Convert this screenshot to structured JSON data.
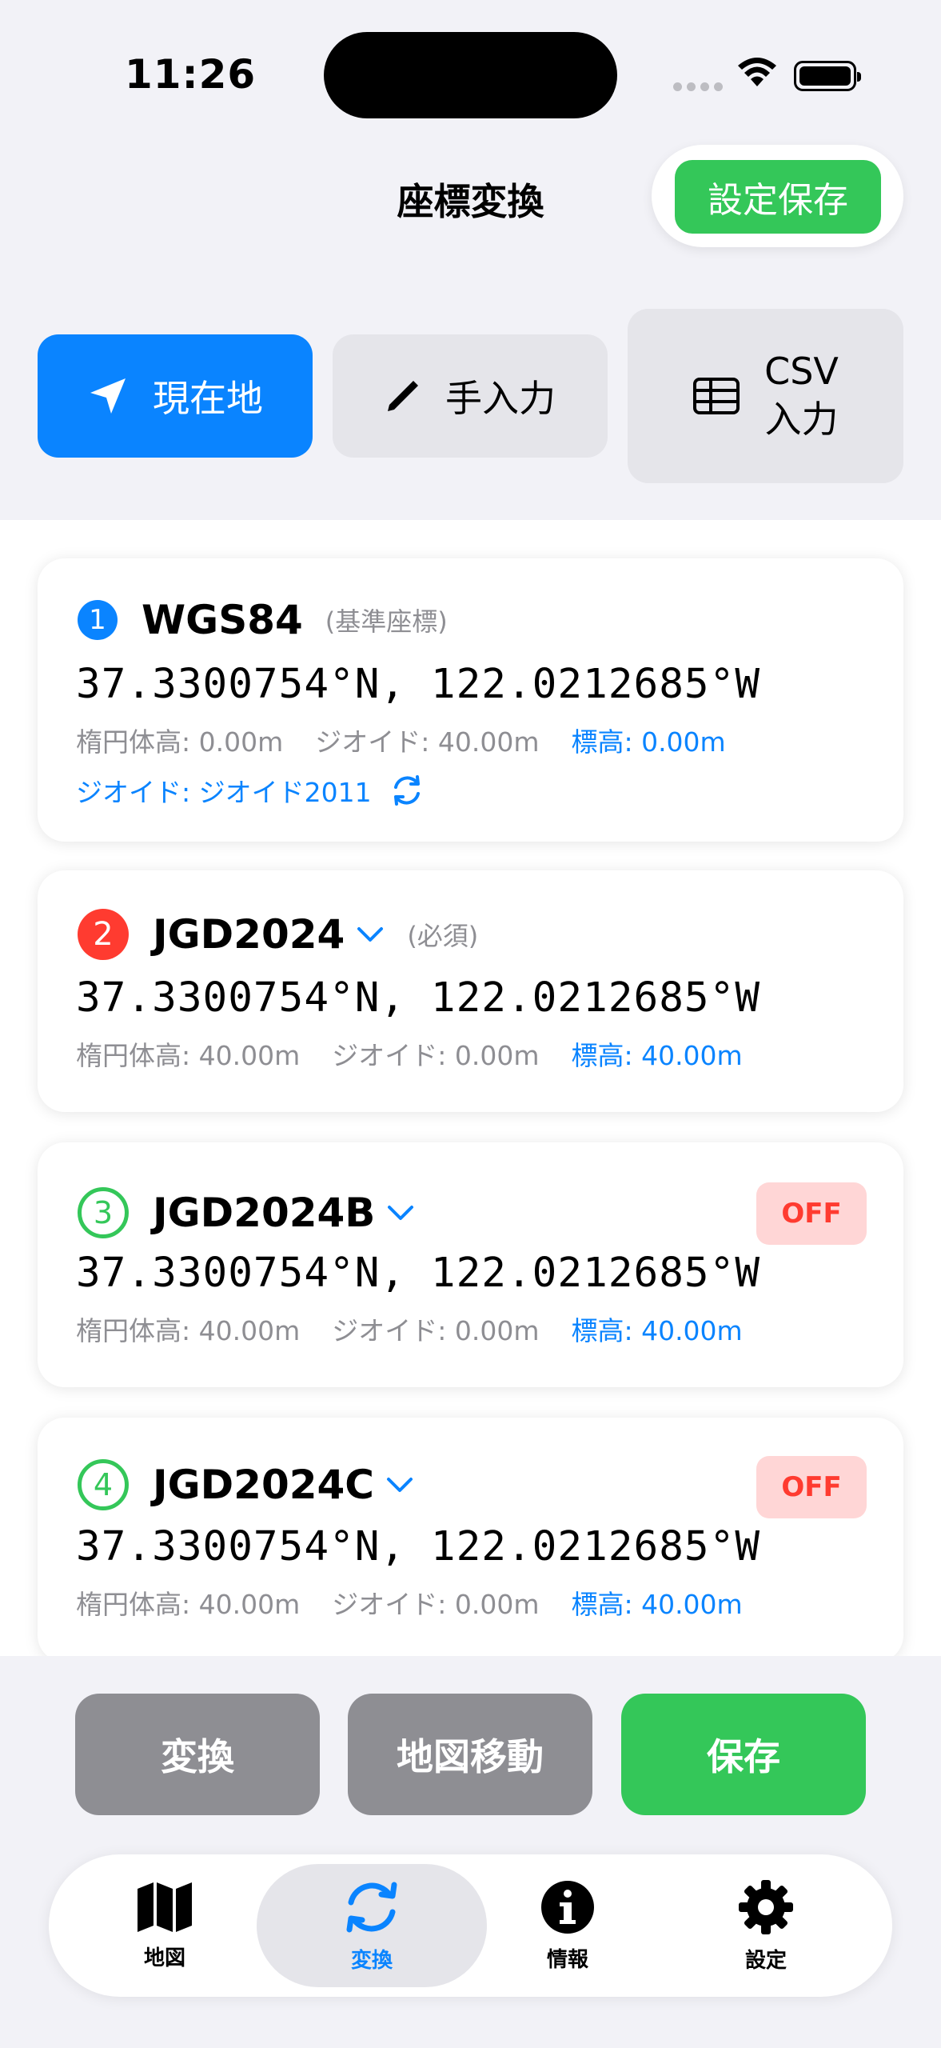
{
  "status_bar": {
    "time": "11:26"
  },
  "nav": {
    "title": "座標変換",
    "save_settings_label": "設定保存"
  },
  "input_modes": [
    {
      "label": "現在地",
      "icon": "location-arrow-icon",
      "active": true
    },
    {
      "label": "手入力",
      "icon": "pencil-icon",
      "active": false
    },
    {
      "label_line1": "CSV",
      "label_line2": "入力",
      "icon": "table-icon",
      "active": false
    }
  ],
  "cards": [
    {
      "number": "1",
      "name": "WGS84",
      "sub": "(基準座標)",
      "coords": "37.3300754°N, 122.0212685°W",
      "ellipsoid": "楕円体高: 0.00m",
      "geoid": "ジオイド: 40.00m",
      "elevation": "標高: 0.00m",
      "geoid_model": "ジオイド: ジオイド2011"
    },
    {
      "number": "2",
      "name": "JGD2024",
      "sub": "(必須)",
      "coords": "37.3300754°N, 122.0212685°W",
      "ellipsoid": "楕円体高: 40.00m",
      "geoid": "ジオイド: 0.00m",
      "elevation": "標高: 40.00m"
    },
    {
      "number": "3",
      "name": "JGD2024B",
      "toggle": "OFF",
      "coords": "37.3300754°N, 122.0212685°W",
      "ellipsoid": "楕円体高: 40.00m",
      "geoid": "ジオイド: 0.00m",
      "elevation": "標高: 40.00m"
    },
    {
      "number": "4",
      "name": "JGD2024C",
      "toggle": "OFF",
      "coords": "37.3300754°N, 122.0212685°W",
      "ellipsoid": "楕円体高: 40.00m",
      "geoid": "ジオイド: 0.00m",
      "elevation": "標高: 40.00m"
    }
  ],
  "actions": {
    "convert": "変換",
    "map_move": "地図移動",
    "save": "保存"
  },
  "tabs": [
    {
      "label": "地図",
      "icon": "map-icon",
      "active": false
    },
    {
      "label": "変換",
      "icon": "convert-icon",
      "active": true
    },
    {
      "label": "情報",
      "icon": "info-icon",
      "active": false
    },
    {
      "label": "設定",
      "icon": "gear-icon",
      "active": false
    }
  ],
  "colors": {
    "blue": "#0a84ff",
    "green": "#34c759",
    "red": "#ff3b30",
    "gray": "#8e8e93"
  }
}
